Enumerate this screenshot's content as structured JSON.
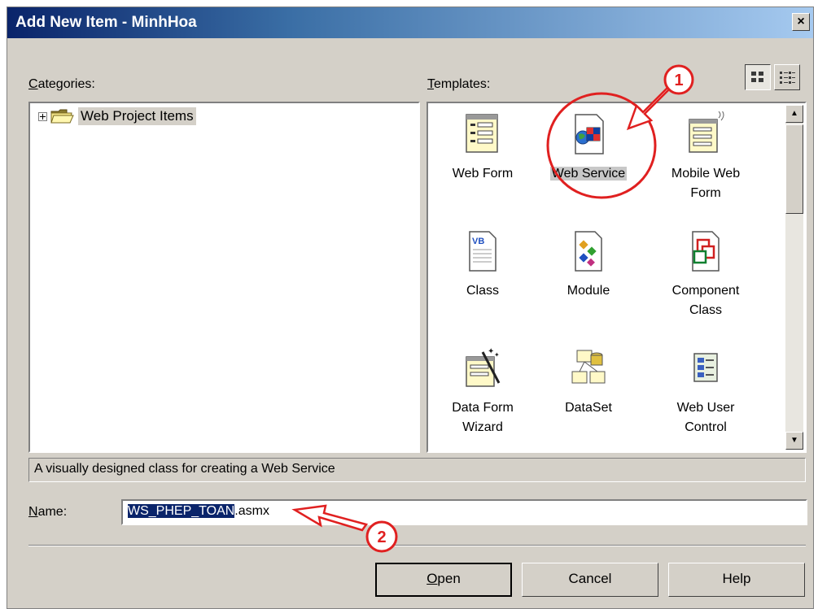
{
  "window": {
    "title": "Add New Item - MinhHoa",
    "close_glyph": "×"
  },
  "categories": {
    "label_prefix": "C",
    "label_rest": "ategories:",
    "tree": [
      {
        "label": "Web Project Items",
        "icon": "folder-icon",
        "expanded": false
      }
    ]
  },
  "templates": {
    "label_prefix": "T",
    "label_rest": "emplates:",
    "view_buttons": [
      {
        "name": "large-icons-view",
        "active": true
      },
      {
        "name": "small-icons-view",
        "active": false
      }
    ],
    "items": [
      {
        "label": "Web Form",
        "icon": "web-form-icon"
      },
      {
        "label": "Web Service",
        "icon": "web-service-icon",
        "selected": true
      },
      {
        "label": "Mobile Web Form",
        "icon": "mobile-web-form-icon"
      },
      {
        "label": "Class",
        "icon": "vb-class-icon"
      },
      {
        "label": "Module",
        "icon": "module-icon"
      },
      {
        "label": "Component Class",
        "icon": "component-class-icon"
      },
      {
        "label": "Data Form Wizard",
        "icon": "data-form-wizard-icon"
      },
      {
        "label": "DataSet",
        "icon": "dataset-icon"
      },
      {
        "label": "Web User Control",
        "icon": "web-user-control-icon"
      }
    ]
  },
  "description": "A visually designed class for creating a Web Service",
  "name_field": {
    "label_prefix": "N",
    "label_rest": "ame:",
    "value_selected": "WS_PHEP_TOAN",
    "value_rest": ".asmx"
  },
  "buttons": {
    "open_prefix": "O",
    "open_rest": "pen",
    "cancel": "Cancel",
    "help": "Help"
  },
  "annotations": {
    "marker_1": "1",
    "marker_2": "2",
    "color": "#e02020"
  }
}
